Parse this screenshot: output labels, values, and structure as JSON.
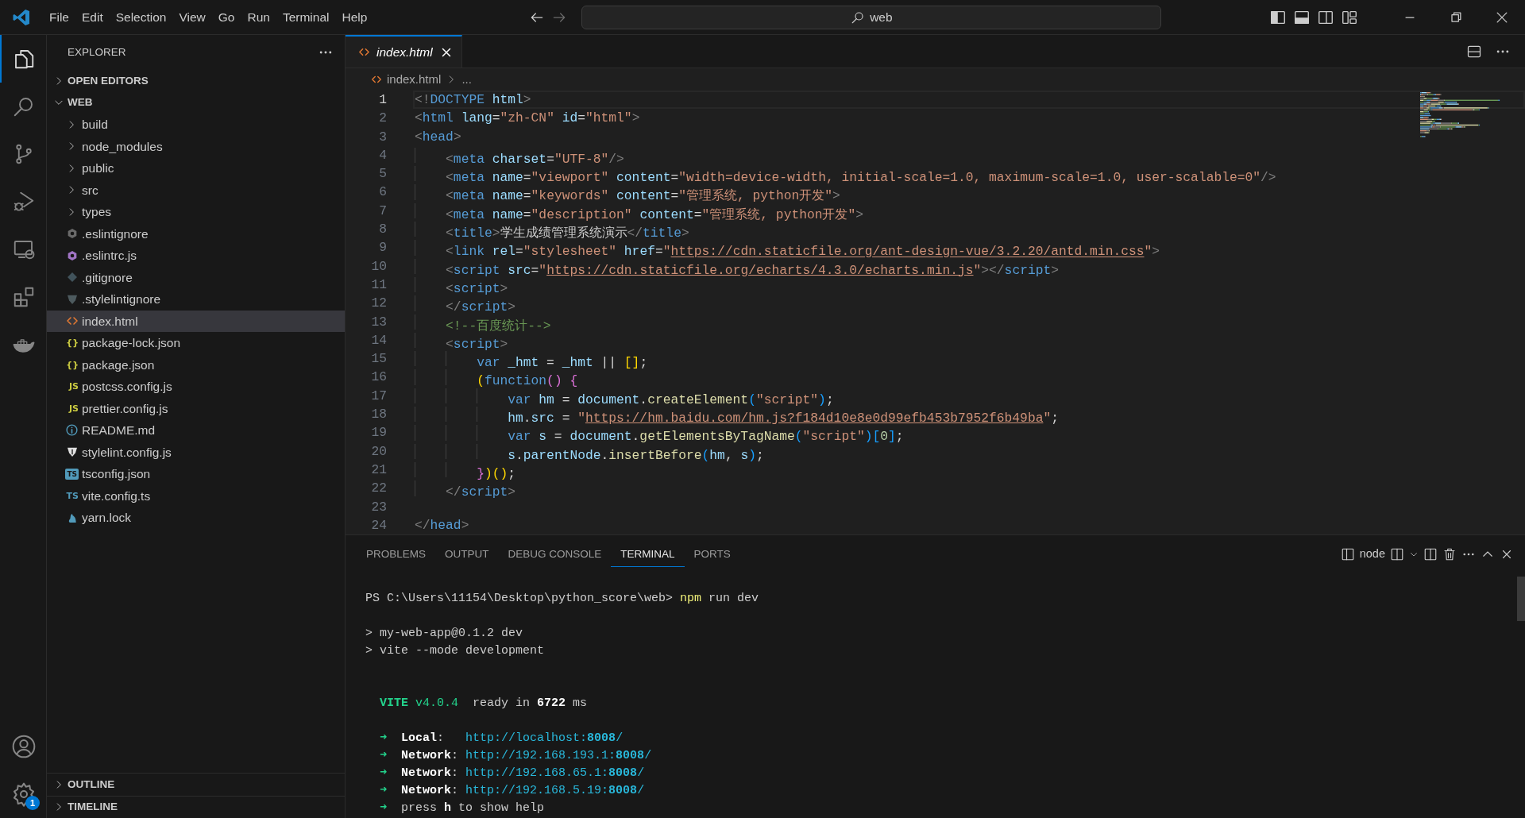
{
  "title_bar": {
    "menu": [
      "File",
      "Edit",
      "Selection",
      "View",
      "Go",
      "Run",
      "Terminal",
      "Help"
    ],
    "navigation": [
      {
        "kind": "back",
        "disabled": false
      },
      {
        "kind": "forward",
        "disabled": true
      }
    ],
    "search": "web",
    "layout_controls": [
      {
        "kind": "primary-sidebar",
        "on": true
      },
      {
        "kind": "panel",
        "on": true
      },
      {
        "kind": "secondary-sidebar",
        "on": false
      },
      {
        "kind": "customize"
      }
    ],
    "window_controls": [
      {
        "kind": "minimize"
      },
      {
        "kind": "restore"
      },
      {
        "kind": "close"
      }
    ]
  },
  "activity_bar": {
    "items": [
      {
        "kind": "explorer",
        "selected": true
      },
      {
        "kind": "search",
        "selected": false
      },
      {
        "kind": "source-control",
        "selected": false
      },
      {
        "kind": "run-debug",
        "selected": false
      },
      {
        "kind": "remote",
        "selected": false
      },
      {
        "kind": "extensions",
        "selected": false
      },
      {
        "kind": "docker",
        "selected": false
      }
    ],
    "bottom_items": [
      {
        "kind": "account"
      },
      {
        "kind": "manage",
        "badge": "1"
      }
    ]
  },
  "sidebar": {
    "title": "EXPLORER",
    "sections": [
      {
        "label": "OPEN EDITORS",
        "expanded": false
      },
      {
        "label": "WEB",
        "expanded": true,
        "children": [
          {
            "label": "build",
            "kind": "folder",
            "expanded": false,
            "selected": false
          },
          {
            "label": "node_modules",
            "kind": "folder",
            "expanded": false,
            "selected": false
          },
          {
            "label": "public",
            "kind": "folder",
            "expanded": false,
            "selected": false
          },
          {
            "label": "src",
            "kind": "folder",
            "expanded": false,
            "selected": false
          },
          {
            "label": "types",
            "kind": "folder",
            "expanded": false,
            "selected": false
          },
          {
            "label": ".eslintignore",
            "kind": "eslintignore",
            "selected": false
          },
          {
            "label": ".eslintrc.js",
            "kind": "eslint",
            "selected": false
          },
          {
            "label": ".gitignore",
            "kind": "git",
            "selected": false
          },
          {
            "label": ".stylelintignore",
            "kind": "stylelintignore",
            "selected": false
          },
          {
            "label": "index.html",
            "kind": "html",
            "selected": true
          },
          {
            "label": "package-lock.json",
            "kind": "json",
            "icon_text": "{}",
            "selected": false
          },
          {
            "label": "package.json",
            "kind": "json",
            "icon_text": "{}",
            "selected": false
          },
          {
            "label": "postcss.config.js",
            "kind": "js",
            "icon_text": "JS",
            "selected": false
          },
          {
            "label": "prettier.config.js",
            "kind": "js",
            "icon_text": "JS",
            "selected": false
          },
          {
            "label": "README.md",
            "kind": "info",
            "selected": false
          },
          {
            "label": "stylelint.config.js",
            "kind": "stylelint",
            "selected": false
          },
          {
            "label": "tsconfig.json",
            "kind": "tsconfig",
            "icon_text": "TS",
            "selected": false
          },
          {
            "label": "vite.config.ts",
            "kind": "ts",
            "icon_text": "TS",
            "selected": false
          },
          {
            "label": "yarn.lock",
            "kind": "yarn",
            "selected": false
          }
        ]
      }
    ],
    "bottom_sections": [
      {
        "label": "OUTLINE",
        "expanded": false
      },
      {
        "label": "TIMELINE",
        "expanded": false
      }
    ]
  },
  "editor": {
    "tabs": [
      {
        "label": "index.html",
        "kind": "html",
        "selected": true,
        "preview": true
      }
    ],
    "breadcrumb": [
      "index.html",
      "..."
    ],
    "lines": [
      {
        "number": "1",
        "current": true,
        "tokens": [
          {
            "text": "<!",
            "kind": "punct"
          },
          {
            "text": "DOCTYPE",
            "kind": "tag"
          },
          {
            "text": " html",
            "kind": "attr"
          },
          {
            "text": ">",
            "kind": "punct"
          }
        ]
      },
      {
        "number": "2",
        "current": false,
        "tokens": [
          {
            "text": "<",
            "kind": "punct"
          },
          {
            "text": "html",
            "kind": "tag"
          },
          {
            "text": " lang",
            "kind": "attr"
          },
          {
            "text": "=",
            "kind": "operator"
          },
          {
            "text": "\"zh-CN\"",
            "kind": "string"
          },
          {
            "text": " id",
            "kind": "attr"
          },
          {
            "text": "=",
            "kind": "operator"
          },
          {
            "text": "\"html\"",
            "kind": "string"
          },
          {
            "text": ">",
            "kind": "punct"
          }
        ]
      },
      {
        "number": "3",
        "current": false,
        "tokens": [
          {
            "text": "<",
            "kind": "punct"
          },
          {
            "text": "head",
            "kind": "tag"
          },
          {
            "text": ">",
            "kind": "punct"
          }
        ]
      },
      {
        "number": "4",
        "current": false,
        "tokens": [
          {
            "text": "    <",
            "kind": "punct"
          },
          {
            "text": "meta",
            "kind": "tag"
          },
          {
            "text": " charset",
            "kind": "attr"
          },
          {
            "text": "=",
            "kind": "operator"
          },
          {
            "text": "\"UTF-8\"",
            "kind": "string"
          },
          {
            "text": "/>",
            "kind": "punct"
          }
        ]
      },
      {
        "number": "5",
        "current": false,
        "tokens": [
          {
            "text": "    <",
            "kind": "punct"
          },
          {
            "text": "meta",
            "kind": "tag"
          },
          {
            "text": " name",
            "kind": "attr"
          },
          {
            "text": "=",
            "kind": "operator"
          },
          {
            "text": "\"viewport\"",
            "kind": "string"
          },
          {
            "text": " content",
            "kind": "attr"
          },
          {
            "text": "=",
            "kind": "operator"
          },
          {
            "text": "\"width=device-width, initial-scale=1.0, maximum-scale=1.0, user-scalable=0\"",
            "kind": "string"
          },
          {
            "text": "/>",
            "kind": "punct"
          }
        ]
      },
      {
        "number": "6",
        "current": false,
        "tokens": [
          {
            "text": "    <",
            "kind": "punct"
          },
          {
            "text": "meta",
            "kind": "tag"
          },
          {
            "text": " name",
            "kind": "attr"
          },
          {
            "text": "=",
            "kind": "operator"
          },
          {
            "text": "\"keywords\"",
            "kind": "string"
          },
          {
            "text": " content",
            "kind": "attr"
          },
          {
            "text": "=",
            "kind": "operator"
          },
          {
            "text": "\"管理系统, python开发\"",
            "kind": "string"
          },
          {
            "text": ">",
            "kind": "punct"
          }
        ]
      },
      {
        "number": "7",
        "current": false,
        "tokens": [
          {
            "text": "    <",
            "kind": "punct"
          },
          {
            "text": "meta",
            "kind": "tag"
          },
          {
            "text": " name",
            "kind": "attr"
          },
          {
            "text": "=",
            "kind": "operator"
          },
          {
            "text": "\"description\"",
            "kind": "string"
          },
          {
            "text": " content",
            "kind": "attr"
          },
          {
            "text": "=",
            "kind": "operator"
          },
          {
            "text": "\"管理系统, python开发\"",
            "kind": "string"
          },
          {
            "text": ">",
            "kind": "punct"
          }
        ]
      },
      {
        "number": "8",
        "current": false,
        "tokens": [
          {
            "text": "    <",
            "kind": "punct"
          },
          {
            "text": "title",
            "kind": "tag"
          },
          {
            "text": ">",
            "kind": "punct"
          },
          {
            "text": "学生成绩管理系统演示",
            "kind": "plain"
          },
          {
            "text": "</",
            "kind": "punct"
          },
          {
            "text": "title",
            "kind": "tag"
          },
          {
            "text": ">",
            "kind": "punct"
          }
        ]
      },
      {
        "number": "9",
        "current": false,
        "tokens": [
          {
            "text": "    <",
            "kind": "punct"
          },
          {
            "text": "link",
            "kind": "tag"
          },
          {
            "text": " rel",
            "kind": "attr"
          },
          {
            "text": "=",
            "kind": "operator"
          },
          {
            "text": "\"stylesheet\"",
            "kind": "string"
          },
          {
            "text": " href",
            "kind": "attr"
          },
          {
            "text": "=",
            "kind": "operator"
          },
          {
            "text": "\"",
            "kind": "string"
          },
          {
            "text": "https://cdn.staticfile.org/ant-design-vue/3.2.20/antd.min.css",
            "kind": "link"
          },
          {
            "text": "\"",
            "kind": "string"
          },
          {
            "text": ">",
            "kind": "punct"
          }
        ]
      },
      {
        "number": "10",
        "current": false,
        "tokens": [
          {
            "text": "    <",
            "kind": "punct"
          },
          {
            "text": "script",
            "kind": "tag"
          },
          {
            "text": " src",
            "kind": "attr"
          },
          {
            "text": "=",
            "kind": "operator"
          },
          {
            "text": "\"",
            "kind": "string"
          },
          {
            "text": "https://cdn.staticfile.org/echarts/4.3.0/echarts.min.js",
            "kind": "link"
          },
          {
            "text": "\"",
            "kind": "string"
          },
          {
            "text": "></",
            "kind": "punct"
          },
          {
            "text": "script",
            "kind": "tag"
          },
          {
            "text": ">",
            "kind": "punct"
          }
        ]
      },
      {
        "number": "11",
        "current": false,
        "tokens": [
          {
            "text": "    <",
            "kind": "punct"
          },
          {
            "text": "script",
            "kind": "tag"
          },
          {
            "text": ">",
            "kind": "punct"
          }
        ]
      },
      {
        "number": "12",
        "current": false,
        "tokens": [
          {
            "text": "    </",
            "kind": "punct"
          },
          {
            "text": "script",
            "kind": "tag"
          },
          {
            "text": ">",
            "kind": "punct"
          }
        ]
      },
      {
        "number": "13",
        "current": false,
        "tokens": [
          {
            "text": "    <!--百度统计-->",
            "kind": "comment"
          }
        ]
      },
      {
        "number": "14",
        "current": false,
        "tokens": [
          {
            "text": "    <",
            "kind": "punct"
          },
          {
            "text": "script",
            "kind": "tag"
          },
          {
            "text": ">",
            "kind": "punct"
          }
        ]
      },
      {
        "number": "15",
        "current": false,
        "tokens": [
          {
            "text": "        var",
            "kind": "keyword"
          },
          {
            "text": " _hmt",
            "kind": "variable"
          },
          {
            "text": " = ",
            "kind": "operator"
          },
          {
            "text": "_hmt",
            "kind": "variable"
          },
          {
            "text": " || ",
            "kind": "operator"
          },
          {
            "text": "[]",
            "kind": "bracket1"
          },
          {
            "text": ";",
            "kind": "operator"
          }
        ]
      },
      {
        "number": "16",
        "current": false,
        "tokens": [
          {
            "text": "        (",
            "kind": "bracket1"
          },
          {
            "text": "function",
            "kind": "keyword"
          },
          {
            "text": "() {",
            "kind": "bracket2"
          }
        ]
      },
      {
        "number": "17",
        "current": false,
        "tokens": [
          {
            "text": "            var",
            "kind": "keyword"
          },
          {
            "text": " hm",
            "kind": "variable"
          },
          {
            "text": " = ",
            "kind": "operator"
          },
          {
            "text": "document",
            "kind": "variable"
          },
          {
            "text": ".",
            "kind": "operator"
          },
          {
            "text": "createElement",
            "kind": "function"
          },
          {
            "text": "(",
            "kind": "bracket3"
          },
          {
            "text": "\"script\"",
            "kind": "string"
          },
          {
            "text": ")",
            "kind": "bracket3"
          },
          {
            "text": ";",
            "kind": "operator"
          }
        ]
      },
      {
        "number": "18",
        "current": false,
        "tokens": [
          {
            "text": "            hm",
            "kind": "variable"
          },
          {
            "text": ".",
            "kind": "operator"
          },
          {
            "text": "src",
            "kind": "variable"
          },
          {
            "text": " = ",
            "kind": "operator"
          },
          {
            "text": "\"",
            "kind": "string"
          },
          {
            "text": "https://hm.baidu.com/hm.js?f184d10e8e0d99efb453b7952f6b49ba",
            "kind": "link"
          },
          {
            "text": "\"",
            "kind": "string"
          },
          {
            "text": ";",
            "kind": "operator"
          }
        ]
      },
      {
        "number": "19",
        "current": false,
        "tokens": [
          {
            "text": "            var",
            "kind": "keyword"
          },
          {
            "text": " s",
            "kind": "variable"
          },
          {
            "text": " = ",
            "kind": "operator"
          },
          {
            "text": "document",
            "kind": "variable"
          },
          {
            "text": ".",
            "kind": "operator"
          },
          {
            "text": "getElementsByTagName",
            "kind": "function"
          },
          {
            "text": "(",
            "kind": "bracket3"
          },
          {
            "text": "\"script\"",
            "kind": "string"
          },
          {
            "text": ")[",
            "kind": "bracket3"
          },
          {
            "text": "0",
            "kind": "number"
          },
          {
            "text": "]",
            "kind": "bracket3"
          },
          {
            "text": ";",
            "kind": "operator"
          }
        ]
      },
      {
        "number": "20",
        "current": false,
        "tokens": [
          {
            "text": "            s",
            "kind": "variable"
          },
          {
            "text": ".",
            "kind": "operator"
          },
          {
            "text": "parentNode",
            "kind": "variable"
          },
          {
            "text": ".",
            "kind": "operator"
          },
          {
            "text": "insertBefore",
            "kind": "function"
          },
          {
            "text": "(",
            "kind": "bracket3"
          },
          {
            "text": "hm",
            "kind": "variable"
          },
          {
            "text": ", ",
            "kind": "operator"
          },
          {
            "text": "s",
            "kind": "variable"
          },
          {
            "text": ")",
            "kind": "bracket3"
          },
          {
            "text": ";",
            "kind": "operator"
          }
        ]
      },
      {
        "number": "21",
        "current": false,
        "tokens": [
          {
            "text": "        }",
            "kind": "bracket2"
          },
          {
            "text": ")()",
            "kind": "bracket1"
          },
          {
            "text": ";",
            "kind": "operator"
          }
        ]
      },
      {
        "number": "22",
        "current": false,
        "tokens": [
          {
            "text": "    </",
            "kind": "punct"
          },
          {
            "text": "script",
            "kind": "tag"
          },
          {
            "text": ">",
            "kind": "punct"
          }
        ]
      },
      {
        "number": "23",
        "current": false
      },
      {
        "number": "24",
        "current": false,
        "tokens": [
          {
            "text": "</",
            "kind": "punct"
          },
          {
            "text": "head",
            "kind": "tag"
          },
          {
            "text": ">",
            "kind": "punct"
          }
        ]
      }
    ]
  },
  "panel": {
    "tabs": [
      {
        "label": "PROBLEMS",
        "selected": false
      },
      {
        "label": "OUTPUT",
        "selected": false
      },
      {
        "label": "DEBUG CONSOLE",
        "selected": false
      },
      {
        "label": "TERMINAL",
        "selected": true
      },
      {
        "label": "PORTS",
        "selected": false
      }
    ],
    "terminal_name": "node",
    "terminal_lines": [
      {
        "kind": "line",
        "segments": [
          {
            "text": "PS C:\\Users\\11154\\Desktop\\python_score\\web> ",
            "kind": "plain"
          },
          {
            "text": "npm",
            "kind": "command"
          },
          {
            "text": " run dev",
            "kind": "plain"
          }
        ]
      },
      {
        "kind": "paragraph",
        "segments": [
          {
            "text": "> my-web-app@0.1.2 dev",
            "kind": "plain"
          }
        ]
      },
      {
        "kind": "line",
        "segments": [
          {
            "text": "> vite --mode development",
            "kind": "plain"
          }
        ]
      },
      {
        "kind": "section",
        "segments": [
          {
            "text": "  VITE",
            "kind": "banner"
          },
          {
            "text": " v4.0.4",
            "kind": "version"
          },
          {
            "text": "  ready in ",
            "kind": "plain"
          },
          {
            "text": "6722",
            "kind": "emphasis"
          },
          {
            "text": " ms",
            "kind": "plain"
          }
        ]
      },
      {
        "kind": "paragraph",
        "segments": [
          {
            "text": "  ➜",
            "kind": "arrow"
          },
          {
            "text": "  Local",
            "kind": "emphasis"
          },
          {
            "text": ":   ",
            "kind": "plain"
          },
          {
            "text": "http://localhost:",
            "kind": "url"
          },
          {
            "text": "8008",
            "kind": "port"
          },
          {
            "text": "/",
            "kind": "url"
          }
        ]
      },
      {
        "kind": "line",
        "segments": [
          {
            "text": "  ➜",
            "kind": "arrow"
          },
          {
            "text": "  Network",
            "kind": "emphasis"
          },
          {
            "text": ": ",
            "kind": "plain"
          },
          {
            "text": "http://192.168.193.1:",
            "kind": "url"
          },
          {
            "text": "8008",
            "kind": "port"
          },
          {
            "text": "/",
            "kind": "url"
          }
        ]
      },
      {
        "kind": "line",
        "segments": [
          {
            "text": "  ➜",
            "kind": "arrow"
          },
          {
            "text": "  Network",
            "kind": "emphasis"
          },
          {
            "text": ": ",
            "kind": "plain"
          },
          {
            "text": "http://192.168.65.1:",
            "kind": "url"
          },
          {
            "text": "8008",
            "kind": "port"
          },
          {
            "text": "/",
            "kind": "url"
          }
        ]
      },
      {
        "kind": "line",
        "segments": [
          {
            "text": "  ➜",
            "kind": "arrow"
          },
          {
            "text": "  Network",
            "kind": "emphasis"
          },
          {
            "text": ": ",
            "kind": "plain"
          },
          {
            "text": "http://192.168.5.19:",
            "kind": "url"
          },
          {
            "text": "8008",
            "kind": "port"
          },
          {
            "text": "/",
            "kind": "url"
          }
        ]
      },
      {
        "kind": "line",
        "segments": [
          {
            "text": "  ➜",
            "kind": "arrow"
          },
          {
            "text": "  press ",
            "kind": "plain"
          },
          {
            "text": "h",
            "kind": "emphasis"
          },
          {
            "text": " to show help",
            "kind": "plain"
          }
        ]
      }
    ]
  }
}
